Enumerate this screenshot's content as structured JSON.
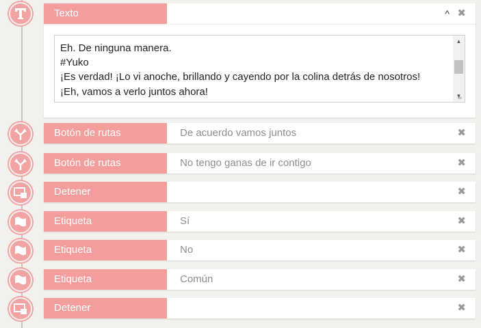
{
  "text_block": {
    "label": "Texto",
    "collapse_icon": "chevron-up-icon",
    "close_icon": "close-icon",
    "lines": [
      "Eh. De ninguna manera.",
      "#Yuko",
      "¡Es verdad! ¡Lo vi anoche, brillando y cayendo por la colina detrás de nosotros!",
      "¡Eh, vamos a verlo juntos ahora!"
    ]
  },
  "rows": [
    {
      "icon": "route-fork-icon",
      "label": "Botón de rutas",
      "value": "De acuerdo vamos juntos"
    },
    {
      "icon": "route-fork-icon",
      "label": "Botón de rutas",
      "value": "No tengo ganas de ir contigo"
    },
    {
      "icon": "stop-window-icon",
      "label": "Detener",
      "value": ""
    },
    {
      "icon": "flag-icon",
      "label": "Etiqueta",
      "value": "Sí"
    },
    {
      "icon": "flag-icon",
      "label": "Etiqueta",
      "value": "No"
    },
    {
      "icon": "flag-icon",
      "label": "Etiqueta",
      "value": "Común"
    },
    {
      "icon": "stop-window-icon",
      "label": "Detener",
      "value": ""
    }
  ],
  "colors": {
    "accent": "#f49d9d",
    "node": "#f2a3a3",
    "background": "#f3f1ee"
  }
}
